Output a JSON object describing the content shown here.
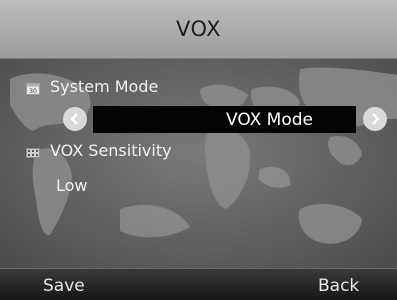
{
  "title": "VOX",
  "items": [
    {
      "label": "System Mode",
      "icon": "calendar-icon",
      "value": "VOX Mode"
    },
    {
      "label": "VOX Sensitivity",
      "icon": "keypad-icon",
      "value": "Low"
    }
  ],
  "softkeys": {
    "left": "Save",
    "right": "Back"
  }
}
